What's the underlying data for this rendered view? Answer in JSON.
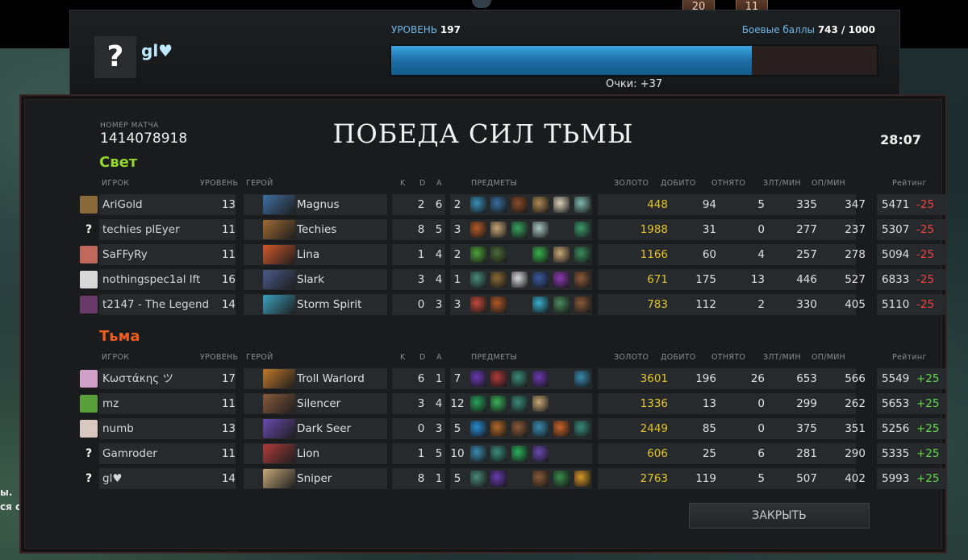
{
  "level_panel": {
    "level_label": "УРОВЕНЬ",
    "level_value": "197",
    "battle_points_label": "Боевые баллы",
    "battle_points_value": "743 / 1000",
    "battle_points_fraction": 0.743,
    "player_name": "gl♥",
    "avatar_placeholder": "?",
    "points_text": "Очки: +37"
  },
  "top_badges": [
    "20",
    "11"
  ],
  "side_text": [
    "ы.",
    "ся с"
  ],
  "match": {
    "id_label": "НОМЕР МАТЧА",
    "id": "1414078918",
    "title": "ПОБЕДА СИЛ ТЬМЫ",
    "duration": "28:07"
  },
  "headers": {
    "player": "ИГРОК",
    "level": "УРОВЕНЬ",
    "hero": "ГЕРОЙ",
    "k": "K",
    "d": "D",
    "a": "A",
    "items": "ПРЕДМЕТЫ",
    "gold": "ЗОЛОТО",
    "last_hits": "ДОБИТО",
    "denies": "ОТНЯТО",
    "gpm": "ЗЛТ/МИН",
    "xpm": "ОП/МИН",
    "rating": "Рейтинг"
  },
  "teams": [
    {
      "name": "Свет",
      "players": [
        {
          "name": "AriGold",
          "level": "13",
          "hero": "Magnus",
          "k": "2",
          "d": "6",
          "a": "2",
          "gold": "448",
          "lh": "94",
          "dn": "5",
          "gpm": "335",
          "xpm": "347",
          "rating": "5471",
          "delta": "-25",
          "avatar": "#8a6a3a",
          "hero_color": "#3e6fa3",
          "items": [
            "#3b8fb8",
            "#3a6fa0",
            "#8a4a2a",
            "#b08a55",
            "#d8d0b8",
            "#7fb8b0"
          ]
        },
        {
          "name": "techies plEyer",
          "level": "11",
          "hero": "Techies",
          "k": "8",
          "d": "5",
          "a": "3",
          "gold": "1988",
          "lh": "31",
          "dn": "0",
          "gpm": "277",
          "xpm": "237",
          "rating": "5307",
          "delta": "-25",
          "avatar": "?",
          "hero_color": "#a06a32",
          "items": [
            "#b55a2a",
            "#c8a878",
            "#3aa060",
            "#a8c8c0",
            "",
            "#3c9a6c"
          ]
        },
        {
          "name": "SaFFyRy",
          "level": "11",
          "hero": "Lina",
          "k": "1",
          "d": "4",
          "a": "2",
          "gold": "1166",
          "lh": "60",
          "dn": "4",
          "gpm": "257",
          "xpm": "278",
          "rating": "5094",
          "delta": "-25",
          "avatar": "#c0685a",
          "hero_color": "#d2582a",
          "items": [
            "#4ea03a",
            "#4c6a3a",
            "",
            "#3ab04e",
            "#c8a878",
            "#3a8a5a"
          ]
        },
        {
          "name": "nothingspec1al lft",
          "level": "16",
          "hero": "Slark",
          "k": "3",
          "d": "4",
          "a": "1",
          "gold": "671",
          "lh": "175",
          "dn": "13",
          "gpm": "446",
          "xpm": "527",
          "rating": "6833",
          "delta": "-25",
          "avatar": "#d8d8d8",
          "hero_color": "#4a5a8a",
          "items": [
            "#4a8a7a",
            "#8a6a3a",
            "#d8d8e0",
            "#3a5aa0",
            "#8a3ab0",
            "#8a5a3a"
          ]
        },
        {
          "name": "t2147 - The Legend",
          "level": "14",
          "hero": "Storm Spirit",
          "k": "0",
          "d": "3",
          "a": "3",
          "gold": "783",
          "lh": "112",
          "dn": "2",
          "gpm": "330",
          "xpm": "405",
          "rating": "5110",
          "delta": "-25",
          "avatar": "#6a3a6a",
          "hero_color": "#3aa0c0",
          "items": [
            "#c04a3a",
            "#b05a2a",
            "",
            "#3ab0d0",
            "#4a8a5a",
            "#8a5a3a"
          ]
        }
      ]
    },
    {
      "name": "Тьма",
      "players": [
        {
          "name": "Κωστάκης ツ",
          "level": "17",
          "hero": "Troll Warlord",
          "k": "6",
          "d": "1",
          "a": "7",
          "gold": "3601",
          "lh": "196",
          "dn": "26",
          "gpm": "653",
          "xpm": "566",
          "rating": "5549",
          "delta": "+25",
          "avatar": "#d0a0c8",
          "hero_color": "#c0782a",
          "items": [
            "#6a3ab0",
            "#b03a3a",
            "#3a8a7a",
            "#6a3ab0",
            "",
            "#3a8ab0"
          ]
        },
        {
          "name": "mz",
          "level": "11",
          "hero": "Silencer",
          "k": "3",
          "d": "4",
          "a": "12",
          "gold": "1336",
          "lh": "13",
          "dn": "0",
          "gpm": "299",
          "xpm": "262",
          "rating": "5653",
          "delta": "+25",
          "avatar": "#5aa03a",
          "hero_color": "#8a5a3a",
          "items": [
            "#2aa05a",
            "#3ab05a",
            "#3a8a7a",
            "#c8a878",
            "",
            ""
          ]
        },
        {
          "name": "numb",
          "level": "13",
          "hero": "Dark Seer",
          "k": "0",
          "d": "3",
          "a": "5",
          "gold": "2449",
          "lh": "85",
          "dn": "0",
          "gpm": "375",
          "xpm": "351",
          "rating": "5256",
          "delta": "+25",
          "avatar": "#d8c8c0",
          "hero_color": "#6a4ab0",
          "items": [
            "#2a8ad0",
            "#b06a2a",
            "#8a5a3a",
            "#3a8ab0",
            "#c8642a",
            "#3a8a7a"
          ]
        },
        {
          "name": "Gamroder",
          "level": "11",
          "hero": "Lion",
          "k": "1",
          "d": "5",
          "a": "10",
          "gold": "606",
          "lh": "25",
          "dn": "6",
          "gpm": "281",
          "xpm": "290",
          "rating": "5335",
          "delta": "+25",
          "avatar": "?",
          "hero_color": "#b03a3a",
          "items": [
            "#3a8ab0",
            "#3a8a7a",
            "#2ab05a",
            "#6a4ab0",
            "",
            ""
          ]
        },
        {
          "name": "gl♥",
          "level": "14",
          "hero": "Sniper",
          "k": "8",
          "d": "1",
          "a": "5",
          "gold": "2763",
          "lh": "119",
          "dn": "5",
          "gpm": "507",
          "xpm": "402",
          "rating": "5993",
          "delta": "+25",
          "avatar": "?",
          "hero_color": "#c8a878",
          "items": [
            "#4a8a7a",
            "#6a3ab0",
            "",
            "#8a5a3a",
            "#3a8a4a",
            "#d89a2a"
          ]
        }
      ]
    }
  ],
  "close_label": "ЗАКРЫТЬ"
}
